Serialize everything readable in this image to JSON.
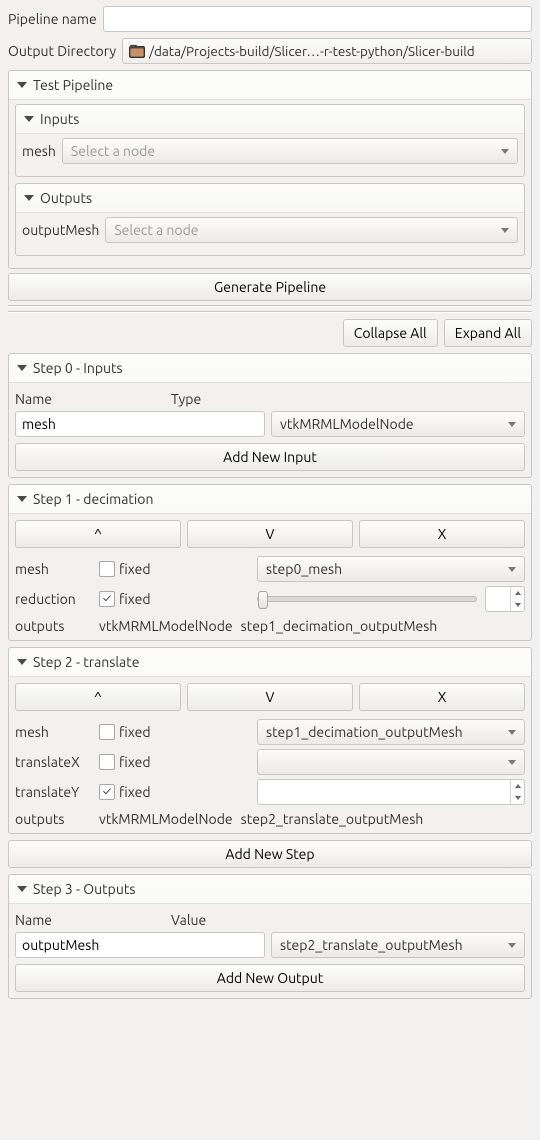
{
  "header": {
    "pipeline_name_label": "Pipeline name",
    "pipeline_name_value": "",
    "output_dir_label": "Output Directory",
    "output_dir_value": "/data/Projects-build/Slicer…-r-test-python/Slicer-build"
  },
  "test_pipeline": {
    "title": "Test Pipeline",
    "inputs": {
      "title": "Inputs",
      "mesh_label": "mesh",
      "mesh_placeholder": "Select a node"
    },
    "outputs": {
      "title": "Outputs",
      "output_mesh_label": "outputMesh",
      "output_mesh_placeholder": "Select a node"
    }
  },
  "generate_btn": "Generate Pipeline",
  "collapse_btn": "Collapse All",
  "expand_btn": "Expand All",
  "step_labels": {
    "up": "^",
    "down": "V",
    "remove": "X",
    "fixed": "fixed",
    "name": "Name",
    "type": "Type",
    "value": "Value"
  },
  "step0": {
    "title": "Step 0 - Inputs",
    "name_value": "mesh",
    "type_value": "vtkMRMLModelNode",
    "add_btn": "Add New Input"
  },
  "step1": {
    "title": "Step 1 - decimation",
    "mesh_label": "mesh",
    "mesh_value": "step0_mesh",
    "mesh_fixed": false,
    "reduction_label": "reduction",
    "reduction_fixed": true,
    "reduction_spin": "",
    "outputs_label": "outputs",
    "outputs_type": "vtkMRMLModelNode",
    "outputs_name": "step1_decimation_outputMesh"
  },
  "step2": {
    "title": "Step 2 - translate",
    "mesh_label": "mesh",
    "mesh_value": "step1_decimation_outputMesh",
    "mesh_fixed": false,
    "translateX_label": "translateX",
    "translateX_fixed": false,
    "translateX_value": "",
    "translateY_label": "translateY",
    "translateY_fixed": true,
    "translateY_value": "",
    "outputs_label": "outputs",
    "outputs_type": "vtkMRMLModelNode",
    "outputs_name": "step2_translate_outputMesh"
  },
  "add_step_btn": "Add New Step",
  "step3": {
    "title": "Step 3 - Outputs",
    "name_value": "outputMesh",
    "value_value": "step2_translate_outputMesh",
    "add_btn": "Add New Output"
  }
}
